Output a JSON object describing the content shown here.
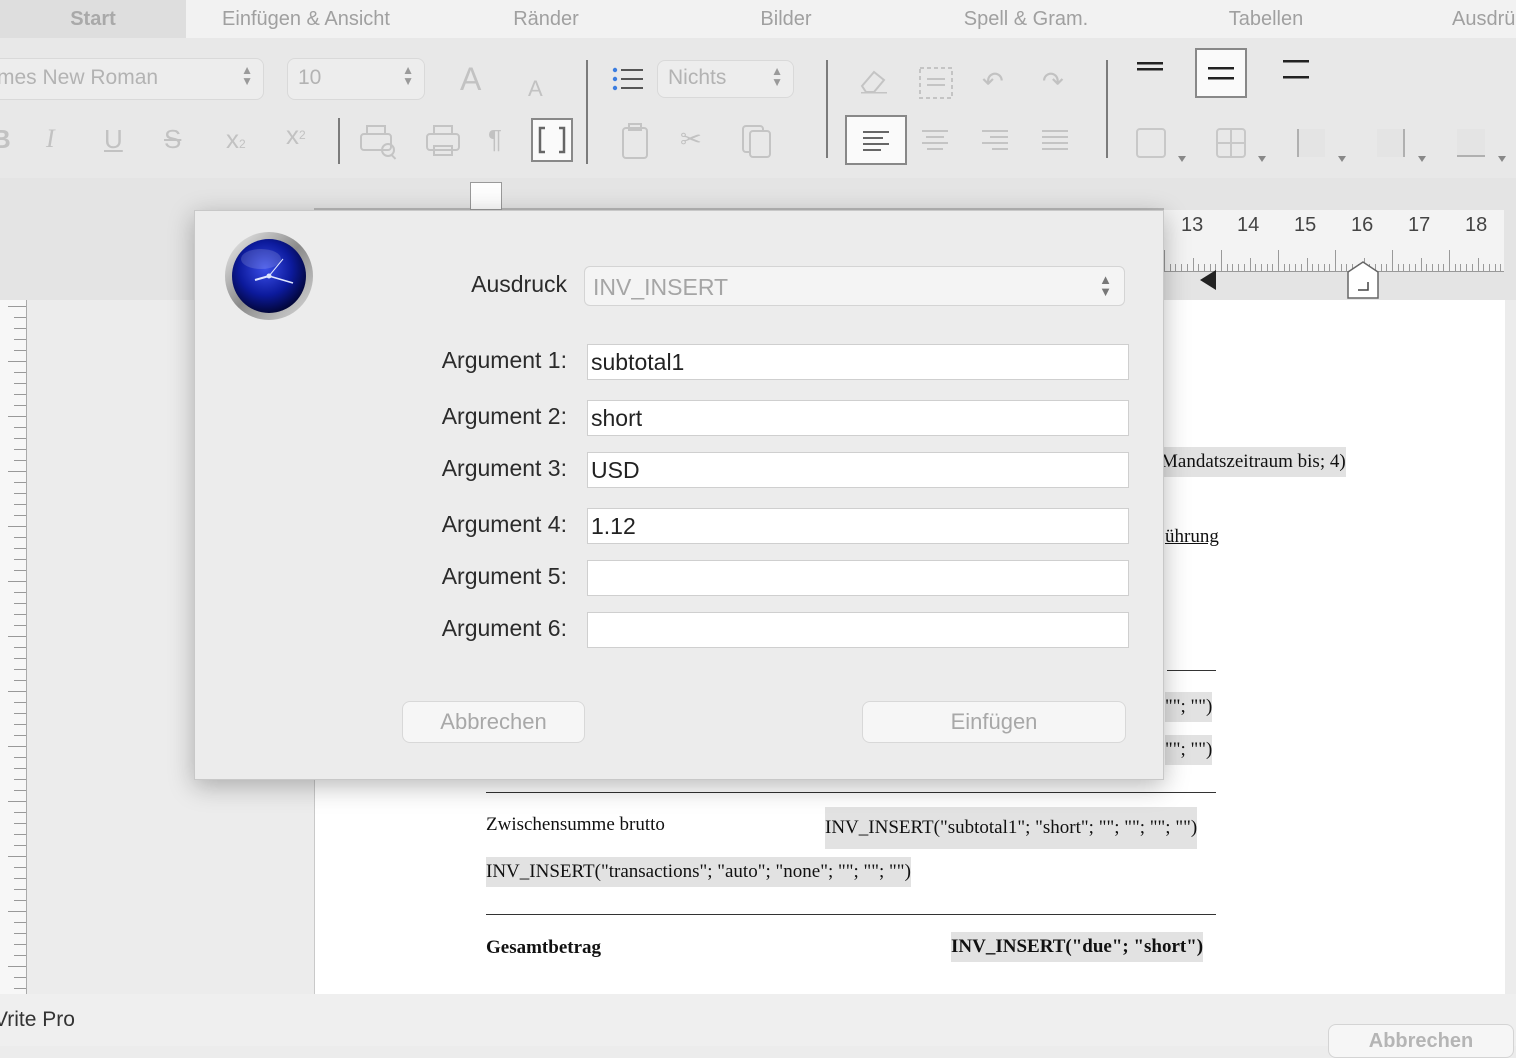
{
  "tabs": [
    {
      "label": "Start",
      "active": true
    },
    {
      "label": "Einfügen & Ansicht"
    },
    {
      "label": "Ränder"
    },
    {
      "label": "Bilder"
    },
    {
      "label": "Spell & Gram."
    },
    {
      "label": "Tabellen"
    },
    {
      "label": "Ausdrü"
    }
  ],
  "toolbar": {
    "font_name": "mes New Roman",
    "font_size": "10",
    "list_style": "Nichts",
    "grow_font": "A",
    "shrink_font": "A",
    "bold": "B",
    "italic": "I",
    "underline": "U",
    "strike": "S",
    "subscript": "x",
    "superscript": "x",
    "pilcrow": "¶",
    "icons": [
      "print-preview-icon",
      "print-icon",
      "pilcrow-icon",
      "brackets-icon",
      "clipboard-icon",
      "scissors-icon",
      "copy-icon",
      "eraser-icon",
      "select-icon",
      "undo-icon",
      "redo-icon",
      "align-left-icon",
      "align-center-icon",
      "align-right-icon",
      "justify-icon",
      "border-icons"
    ]
  },
  "ruler": {
    "numbers": [
      "13",
      "14",
      "15",
      "16",
      "17",
      "18"
    ]
  },
  "document": {
    "line_mandat": "Mandatszeitraum bis; 4)",
    "line_fuhrung": "ührung",
    "line_row1_end": "\"\"; \"\")",
    "line_row2_end": "\"\"; \"\")",
    "zwischensumme_label": "Zwischensumme brutto",
    "zwischensumme_value": "INV_INSERT(\"subtotal1\"; \"short\"; \"\"; \"\"; \"\"; \"\")",
    "transactions": "INV_INSERT(\"transactions\"; \"auto\"; \"none\"; \"\"; \"\"; \"\")",
    "gesamtbetrag_label": "Gesamtbetrag",
    "gesamtbetrag_value": "INV_INSERT(\"due\"; \"short\")"
  },
  "dialog": {
    "expression_label": "Ausdruck",
    "expression_value": "INV_INSERT",
    "arguments": [
      {
        "label": "Argument 1:",
        "value": "subtotal1"
      },
      {
        "label": "Argument 2:",
        "value": "short"
      },
      {
        "label": "Argument 3:",
        "value": "USD"
      },
      {
        "label": "Argument 4:",
        "value": "1.12"
      },
      {
        "label": "Argument 5:",
        "value": ""
      },
      {
        "label": "Argument 6:",
        "value": ""
      }
    ],
    "cancel_label": "Abbrechen",
    "insert_label": "Einfügen",
    "icon": "clock-icon"
  },
  "statusbar": {
    "title": "Vrite Pro",
    "cancel_label": "Abbrechen"
  }
}
